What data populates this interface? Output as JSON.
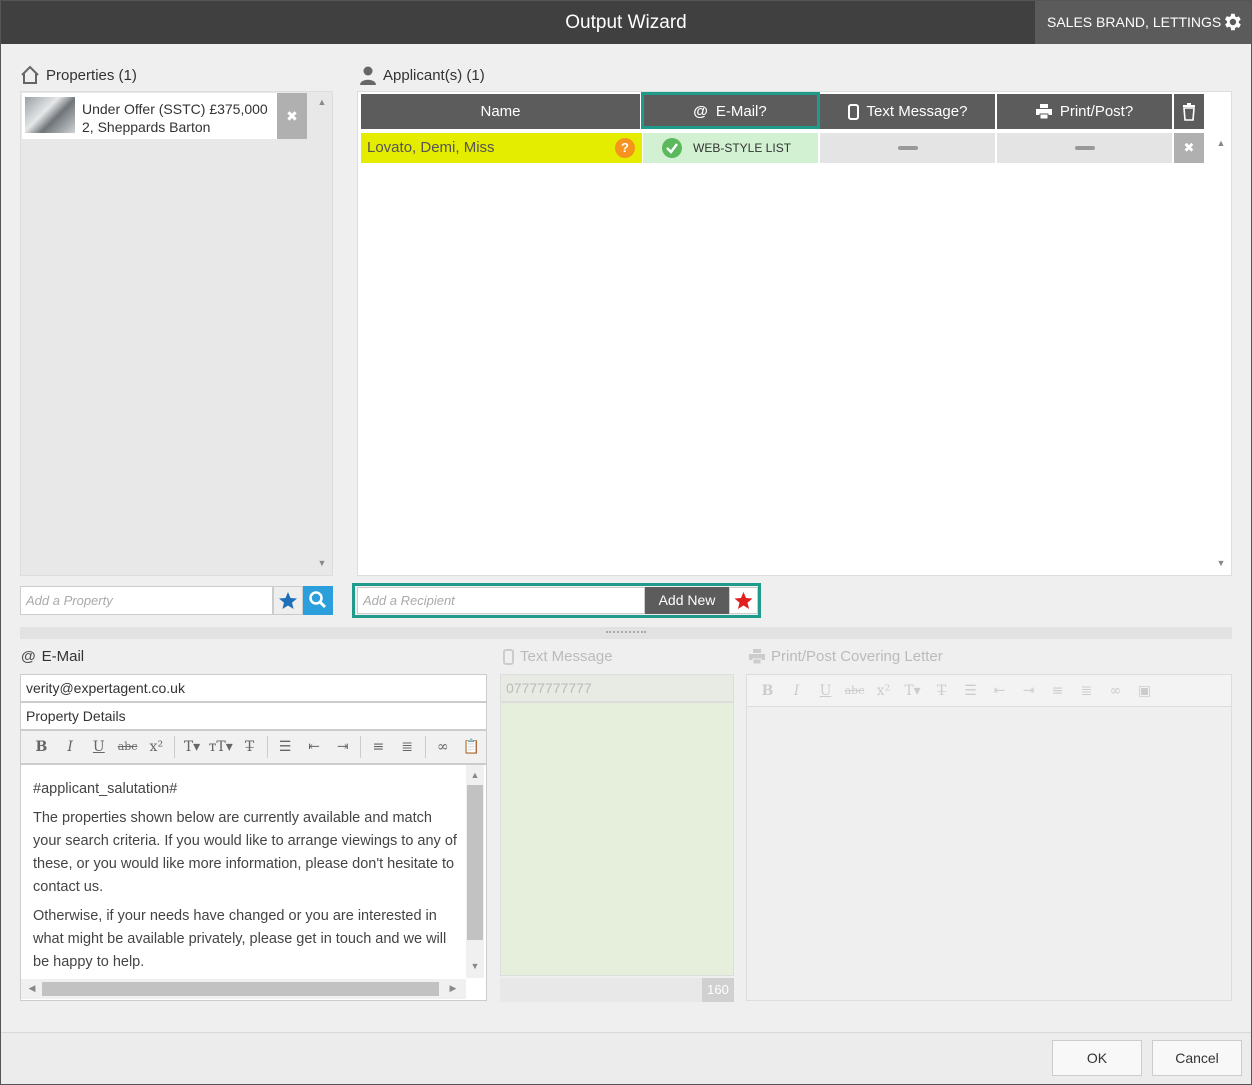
{
  "window": {
    "title": "Output Wizard",
    "brand": "SALES BRAND, LETTINGS"
  },
  "properties": {
    "header": "Properties (1)",
    "items": [
      {
        "line1": "Under Offer (SSTC) £375,000",
        "line2": "2, Sheppards Barton"
      }
    ],
    "add_placeholder": "Add a Property"
  },
  "applicants": {
    "header": "Applicant(s) (1)",
    "columns": {
      "name": "Name",
      "email": "E-Mail?",
      "text": "Text Message?",
      "print": "Print/Post?"
    },
    "rows": [
      {
        "name": "Lovato, Demi, Miss",
        "email_status": "WEB-STYLE LIST"
      }
    ],
    "add_placeholder": "Add a Recipient",
    "add_new": "Add New"
  },
  "email": {
    "header": "E-Mail",
    "to": "verity@expertagent.co.uk",
    "subject": "Property Details",
    "body": [
      "#applicant_salutation#",
      "The properties shown below are currently available and match your search criteria. If you would like to arrange viewings to any of these, or you would like more information, please don't hesitate to contact us.",
      "Otherwise, if your needs have changed or you are interested in what might be available privately, please get in touch and we will be happy to help."
    ]
  },
  "text_message": {
    "header": "Text Message",
    "number": "07777777777",
    "char_count": "160"
  },
  "print": {
    "header": "Print/Post Covering Letter"
  },
  "footer": {
    "ok": "OK",
    "cancel": "Cancel"
  },
  "colors": {
    "accent_outline": "#1e9b8a",
    "name_highlight": "#e4ec00",
    "search_button": "#2b9fdb"
  }
}
